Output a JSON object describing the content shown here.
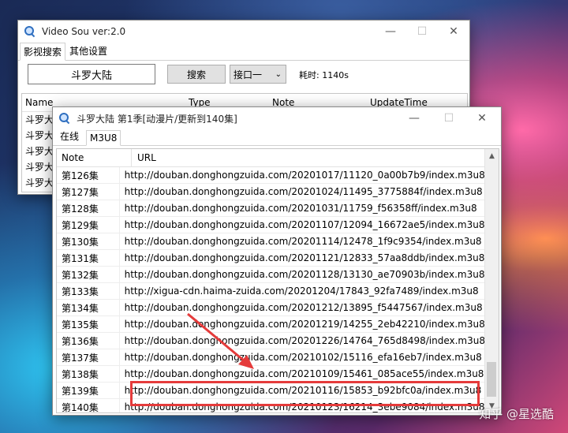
{
  "main_window": {
    "title": "Video Sou ver:2.0",
    "tabs": [
      "影视搜索",
      "其他设置"
    ],
    "search_value": "斗罗大陆",
    "search_button": "搜索",
    "interface_select": "接口一",
    "elapsed_label": "耗时: 1140s",
    "columns": [
      "Name",
      "Type",
      "Note",
      "UpdateTime"
    ],
    "rows": [
      "斗罗大",
      "斗罗大",
      "斗罗大",
      "斗罗大",
      "斗罗大"
    ]
  },
  "detail_window": {
    "title": "斗罗大陆 第1季[动漫片/更新到140集]",
    "tabs": [
      "在线",
      "M3U8"
    ],
    "columns": [
      "Note",
      "URL"
    ],
    "rows": [
      {
        "note": "第126集",
        "url": "http://douban.donghongzuida.com/20201017/11120_0a00b7b9/index.m3u8"
      },
      {
        "note": "第127集",
        "url": "http://douban.donghongzuida.com/20201024/11495_3775884f/index.m3u8"
      },
      {
        "note": "第128集",
        "url": "http://douban.donghongzuida.com/20201031/11759_f56358ff/index.m3u8"
      },
      {
        "note": "第129集",
        "url": "http://douban.donghongzuida.com/20201107/12094_16672ae5/index.m3u8"
      },
      {
        "note": "第130集",
        "url": "http://douban.donghongzuida.com/20201114/12478_1f9c9354/index.m3u8"
      },
      {
        "note": "第131集",
        "url": "http://douban.donghongzuida.com/20201121/12833_57aa8ddb/index.m3u8"
      },
      {
        "note": "第132集",
        "url": "http://douban.donghongzuida.com/20201128/13130_ae70903b/index.m3u8"
      },
      {
        "note": "第133集",
        "url": "http://xigua-cdn.haima-zuida.com/20201204/17843_92fa7489/index.m3u8"
      },
      {
        "note": "第134集",
        "url": "http://douban.donghongzuida.com/20201212/13895_f5447567/index.m3u8"
      },
      {
        "note": "第135集",
        "url": "http://douban.donghongzuida.com/20201219/14255_2eb42210/index.m3u8"
      },
      {
        "note": "第136集",
        "url": "http://douban.donghongzuida.com/20201226/14764_765d8498/index.m3u8"
      },
      {
        "note": "第137集",
        "url": "http://douban.donghongzuida.com/20210102/15116_efa16eb7/index.m3u8"
      },
      {
        "note": "第138集",
        "url": "http://douban.donghongzuida.com/20210109/15461_085ace55/index.m3u8"
      },
      {
        "note": "第139集",
        "url": "http://douban.donghongzuida.com/20210116/15853_b92bfc0a/index.m3u8"
      },
      {
        "note": "第140集",
        "url": "http://douban.donghongzuida.com/20210123/16214_3ebe9084/index.m3u8"
      }
    ]
  },
  "watermark": "知乎 @星选酷",
  "colors": {
    "callout": "#e53b3b",
    "accent": "#2f6fc0"
  }
}
